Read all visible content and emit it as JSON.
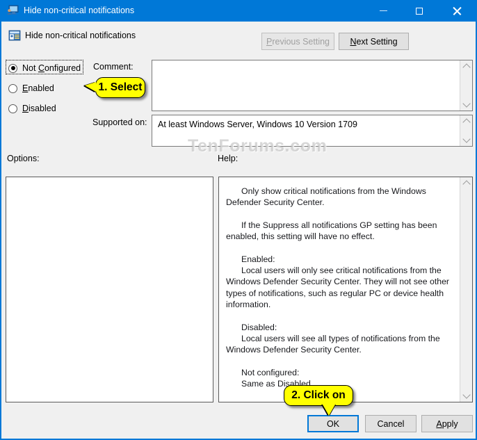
{
  "window": {
    "title": "Hide non-critical notifications",
    "icon": "computer-user-icon",
    "controls": {
      "minimize": "Minimize",
      "maximize": "Maximize",
      "close": "Close"
    }
  },
  "header": {
    "title": "Hide non-critical notifications",
    "icon": "policy-setting-icon"
  },
  "nav": {
    "previous_setting": "Previous Setting",
    "previous_mnemonic": "P",
    "previous_enabled": false,
    "next_setting": "Next Setting",
    "next_mnemonic": "N",
    "next_enabled": true
  },
  "state_options": {
    "selected": "not_configured",
    "items": [
      {
        "id": "not_configured",
        "label_pre": "Not ",
        "label_mnemonic": "C",
        "label_post": "onfigured",
        "checked": true
      },
      {
        "id": "enabled",
        "label_pre": "",
        "label_mnemonic": "E",
        "label_post": "nabled",
        "checked": false
      },
      {
        "id": "disabled",
        "label_pre": "",
        "label_mnemonic": "D",
        "label_post": "isabled",
        "checked": false
      }
    ]
  },
  "fields": {
    "comment_label": "Comment:",
    "comment_value": "",
    "supported_label": "Supported on:",
    "supported_value": "At least Windows Server, Windows 10 Version 1709"
  },
  "panes": {
    "options_label": "Options:",
    "options_content": "",
    "help_label": "Help:",
    "help_paragraphs": [
      "Only show critical notifications from the Windows Defender Security Center.",
      "If the Suppress all notifications GP setting has been enabled, this setting will have no effect.",
      "Enabled:",
      "Local users will only see critical notifications from the Windows Defender Security Center. They will not see other types of notifications, such as regular PC or device health information.",
      "Disabled:",
      "Local users will see all types of notifications from the Windows Defender Security Center.",
      "Not configured:",
      "Same as Disabled."
    ]
  },
  "footer": {
    "ok": "OK",
    "cancel": "Cancel",
    "apply_pre": "",
    "apply_mnemonic": "A",
    "apply_post": "pply",
    "default_button": "OK"
  },
  "callouts": [
    {
      "id": "step-1",
      "text": "1. Select",
      "points_to": "enabled-radio",
      "direction": "left"
    },
    {
      "id": "step-2",
      "text": "2. Click on",
      "points_to": "ok-button",
      "direction": "down"
    }
  ],
  "watermark": {
    "text": "TenForums.com"
  },
  "colors": {
    "titlebar": "#0078d7",
    "window_background": "#f0f0f0",
    "accent": "#0078d7",
    "callout_fill": "#ffff00",
    "text": "#000000"
  }
}
